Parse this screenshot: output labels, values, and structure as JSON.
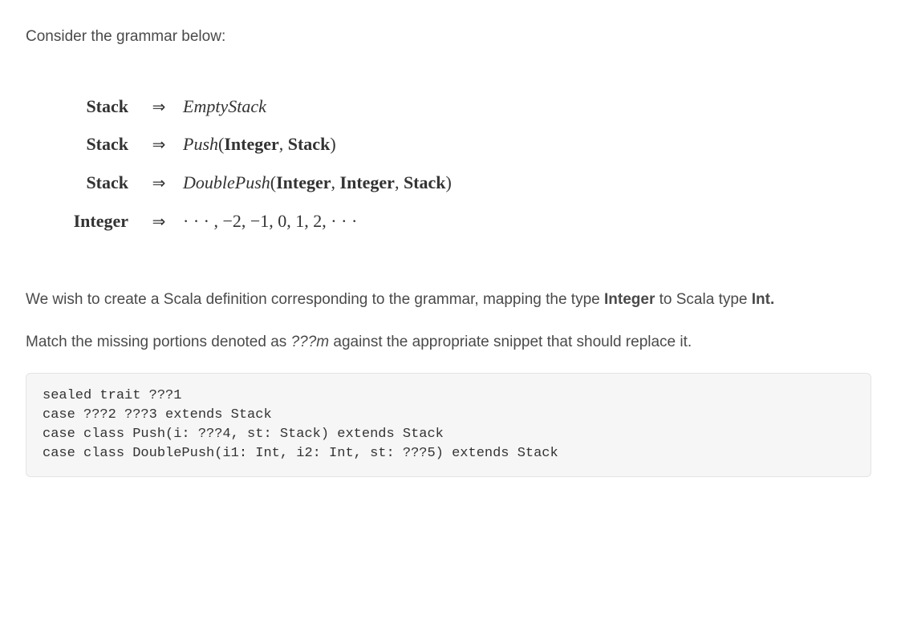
{
  "intro": "Consider the grammar below:",
  "grammar": {
    "arrow": "⇒",
    "rows": [
      {
        "lhs": "Stack",
        "rhs_kind": "emptystack"
      },
      {
        "lhs": "Stack",
        "rhs_kind": "push"
      },
      {
        "lhs": "Stack",
        "rhs_kind": "doublepush"
      },
      {
        "lhs": "Integer",
        "rhs_kind": "integers"
      }
    ],
    "terms": {
      "EmptyStack": "EmptyStack",
      "Push": "Push",
      "DoublePush": "DoublePush",
      "Integer": "Integer",
      "Stack": "Stack",
      "integers_seq": "· · · , −2, −1, 0, 1, 2, · · ·"
    }
  },
  "paragraph1_pre": "We wish to create a Scala definition corresponding to the grammar, mapping the type ",
  "paragraph1_bold1": "Integer",
  "paragraph1_mid": " to Scala type ",
  "paragraph1_bold2": "Int.",
  "paragraph2_pre": "Match the missing portions denoted as ",
  "paragraph2_em": "???m",
  "paragraph2_post": " against the appropriate snippet that should replace it.",
  "code": "sealed trait ???1\ncase ???2 ???3 extends Stack\ncase class Push(i: ???4, st: Stack) extends Stack\ncase class DoublePush(i1: Int, i2: Int, st: ???5) extends Stack"
}
